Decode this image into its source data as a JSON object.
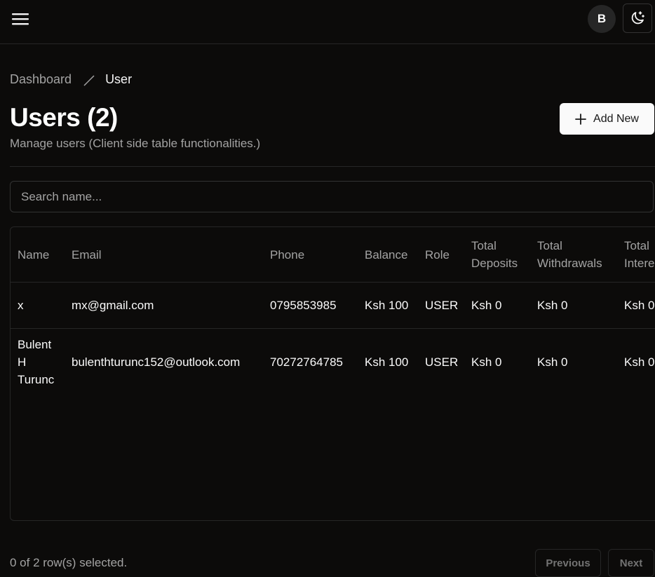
{
  "header": {
    "avatar_initial": "B",
    "icons": {
      "menu": "hamburger-menu-icon",
      "theme": "moon-stars-icon"
    }
  },
  "breadcrumb": {
    "items": [
      "Dashboard",
      "User"
    ]
  },
  "page": {
    "title": "Users (2)",
    "subtitle": "Manage users (Client side table functionalities.)",
    "add_button_label": "Add New"
  },
  "search": {
    "placeholder": "Search name..."
  },
  "table": {
    "headers": {
      "name": "Name",
      "email": "Email",
      "phone": "Phone",
      "balance": "Balance",
      "role": "Role",
      "total_deposits": "Total\nDeposits",
      "total_withdrawals": "Total\nWithdrawals",
      "total_interest": "Total\nInterest"
    },
    "rows": [
      {
        "name": "x",
        "email": "mx@gmail.com",
        "phone": "0795853985",
        "balance": "Ksh 100",
        "role": "USER",
        "total_deposits": "Ksh 0",
        "total_withdrawals": "Ksh 0",
        "total_interest": "Ksh 0"
      },
      {
        "name": "Bulent\nH\nTurunc",
        "email": "bulenthturunc152@outlook.com",
        "phone": "70272764785",
        "balance": "Ksh 100",
        "role": "USER",
        "total_deposits": "Ksh 0",
        "total_withdrawals": "Ksh 0",
        "total_interest": "Ksh 0"
      }
    ]
  },
  "footer": {
    "selection_text": "0 of 2 row(s) selected.",
    "previous_label": "Previous",
    "next_label": "Next"
  }
}
